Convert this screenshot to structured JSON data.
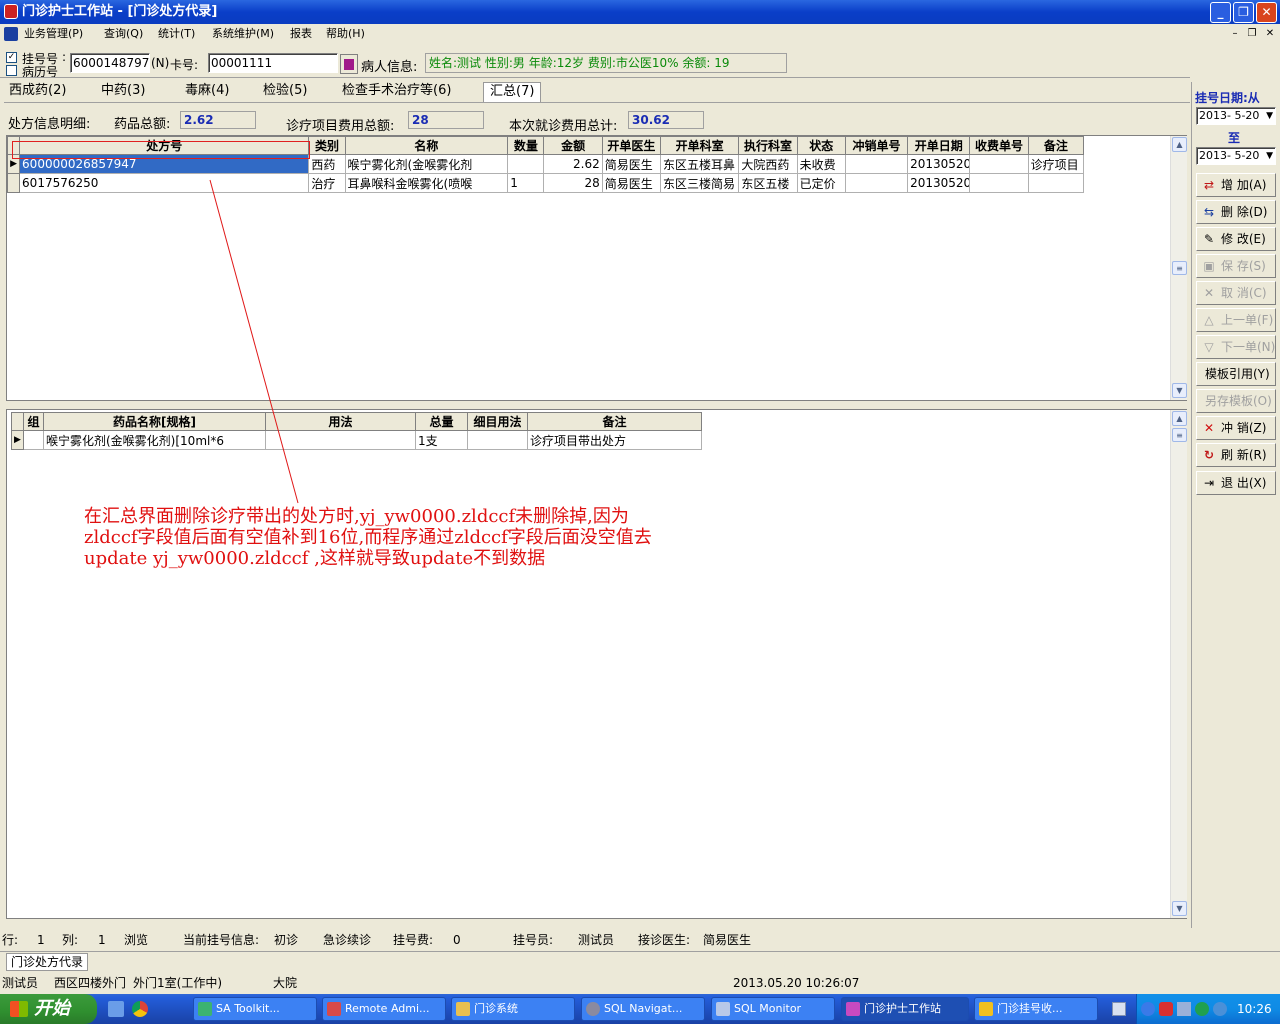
{
  "window": {
    "title": "门诊护士工作站 - [门诊处方代录]"
  },
  "menu": [
    "业务管理(P)",
    "查询(Q)",
    "统计(T)",
    "系统维护(M)",
    "报表",
    "帮助(H)"
  ],
  "patient": {
    "check_label": "挂号号",
    "check_label2": "病历号",
    "reg_no": "6000148797",
    "n_key": "(N)",
    "card_label": "卡号:",
    "card_no": "00001111",
    "info_label": "病人信息:",
    "info": "姓名:测试 性别:男 年龄:12岁 费别:市公医10% 余额: 19"
  },
  "tabs": [
    "西成药(2)",
    "中药(3)",
    "毒麻(4)",
    "检验(5)",
    "检查手术治疗等(6)",
    "汇总(7)"
  ],
  "summary": {
    "detail_label": "处方信息明细:",
    "drug_total_label": "药品总额:",
    "drug_total": "2.62",
    "item_total_label": "诊疗项目费用总额:",
    "item_total": "28",
    "visit_total_label": "本次就诊费用总计:",
    "visit_total": "30.62"
  },
  "top_grid": {
    "headers": [
      "处方号",
      "类别",
      "名称",
      "数量",
      "金额",
      "开单医生",
      "开单科室",
      "执行科室",
      "状态",
      "冲销单号",
      "开单日期",
      "收费单号",
      "备注"
    ],
    "rows": [
      [
        "600000026857947",
        "西药",
        "喉宁雾化剂(金喉雾化剂",
        "",
        "2.62",
        "简易医生",
        "东区五楼耳鼻",
        "大院西药",
        "未收费",
        "",
        "20130520",
        "",
        "诊疗项目"
      ],
      [
        "6017576250",
        "治疗",
        "耳鼻喉科金喉雾化(喷喉",
        "1",
        "28",
        "简易医生",
        "东区三楼简易",
        "东区五楼",
        "已定价",
        "",
        "20130520",
        "",
        ""
      ]
    ]
  },
  "bottom_grid": {
    "headers": [
      "组",
      "药品名称[规格]",
      "用法",
      "总量",
      "细目用法",
      "备注"
    ],
    "rows": [
      [
        "",
        "喉宁雾化剂(金喉雾化剂)[10ml*6",
        "",
        "1支",
        "",
        "诊疗项目带出处方"
      ]
    ]
  },
  "annotation": {
    "line1": "在汇总界面删除诊疗带出的处方时,yj_yw0000.zldccf未删除掉,因为",
    "line2": "zldccf字段值后面有空值补到16位,而程序通过zldccf字段后面没空值去",
    "line3": "update yj_yw0000.zldccf ,这样就导致update不到数据"
  },
  "right_panel": {
    "date_label": "挂号日期:从",
    "date_from": "2013- 5-20",
    "to_label": "至",
    "date_to": "2013- 5-20",
    "buttons": [
      {
        "label": "增  加(A)",
        "icon": "add-icon",
        "enabled": true
      },
      {
        "label": "删  除(D)",
        "icon": "delete-icon",
        "enabled": true
      },
      {
        "label": "修  改(E)",
        "icon": "edit-icon",
        "enabled": true
      },
      {
        "label": "保  存(S)",
        "icon": "save-icon",
        "enabled": false
      },
      {
        "label": "取  消(C)",
        "icon": "cancel-icon",
        "enabled": false
      },
      {
        "label": "上一单(F)",
        "icon": "prev-icon",
        "enabled": false
      },
      {
        "label": "下一单(N)",
        "icon": "next-icon",
        "enabled": false
      },
      {
        "label": "模板引用(Y)",
        "icon": "",
        "enabled": true
      },
      {
        "label": "另存模板(O)",
        "icon": "",
        "enabled": false
      },
      {
        "label": "冲  销(Z)",
        "icon": "reverse-icon",
        "enabled": true
      },
      {
        "label": "刷  新(R)",
        "icon": "refresh-icon",
        "enabled": true
      },
      {
        "label": "退  出(X)",
        "icon": "exit-icon",
        "enabled": true
      }
    ]
  },
  "status1": {
    "row_label": "行:",
    "row": "1",
    "col_label": "列:",
    "col": "1",
    "mode": "浏览",
    "reg_info_label": "当前挂号信息:",
    "visit_type": "初诊",
    "emergency": "急诊续诊",
    "fee_label": "挂号费:",
    "fee": "0",
    "clerk_label": "挂号员:",
    "clerk": "测试员",
    "doctor_label": "接诊医生:",
    "doctor": "简易医生"
  },
  "doc_tab": "门诊处方代录",
  "status2": {
    "user": "测试员",
    "dept": "西区四楼外门",
    "room": "外门1室(工作中)",
    "site": "大院",
    "datetime": "2013.05.20 10:26:07"
  },
  "taskbar": {
    "start": "开始",
    "tasks": [
      "SA Toolkit...",
      "Remote Admi...",
      "门诊系统",
      "SQL Navigat...",
      "SQL Monitor",
      "门诊护士工作站",
      "门诊挂号收..."
    ],
    "clock": "10:26"
  }
}
